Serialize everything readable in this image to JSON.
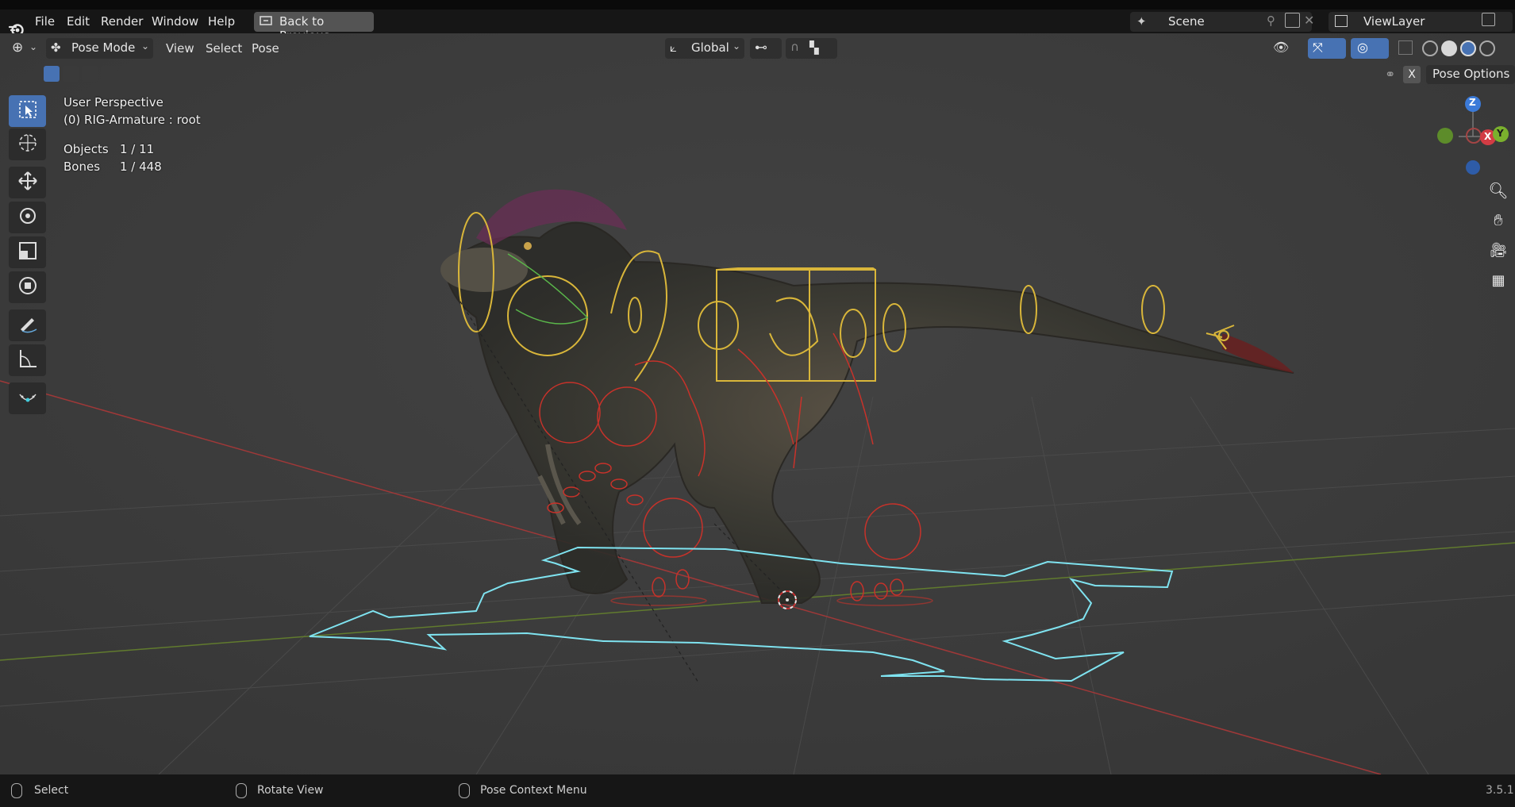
{
  "menubar": {
    "items": [
      "File",
      "Edit",
      "Render",
      "Window",
      "Help"
    ],
    "back_button": "Back to Previous",
    "scene_label": "Scene",
    "viewlayer_label": "ViewLayer"
  },
  "header": {
    "mode": "Pose Mode",
    "menus": [
      "View",
      "Select",
      "Pose"
    ],
    "transform_orientation": "Global",
    "pose_options": "Pose Options",
    "x_mirror": "X"
  },
  "overlay": {
    "view_name": "User Perspective",
    "active": "(0) RIG-Armature : root",
    "stats": [
      {
        "label": "Objects",
        "value": "1 / 11"
      },
      {
        "label": "Bones",
        "value": "1 / 448"
      }
    ]
  },
  "gizmo": {
    "z": "Z",
    "x": "X",
    "y": "Y"
  },
  "toolbar": {
    "tools": [
      "select-box-tool",
      "cursor-tool",
      "move-tool",
      "rotate-tool",
      "scale-tool",
      "transform-tool",
      "annotate-tool",
      "measure-tool",
      "relax-pose-tool"
    ]
  },
  "statusbar": {
    "left": "Select",
    "middle": "Rotate View",
    "right": "Pose Context Menu",
    "version": "3.5.1"
  },
  "colors": {
    "accent": "#4772b3",
    "bone_yellow": "#d9b63a",
    "bone_red": "#c8322a",
    "root_cyan": "#7fe3f0",
    "axis_red": "#b03a3a",
    "axis_green": "#6a8a2a"
  }
}
